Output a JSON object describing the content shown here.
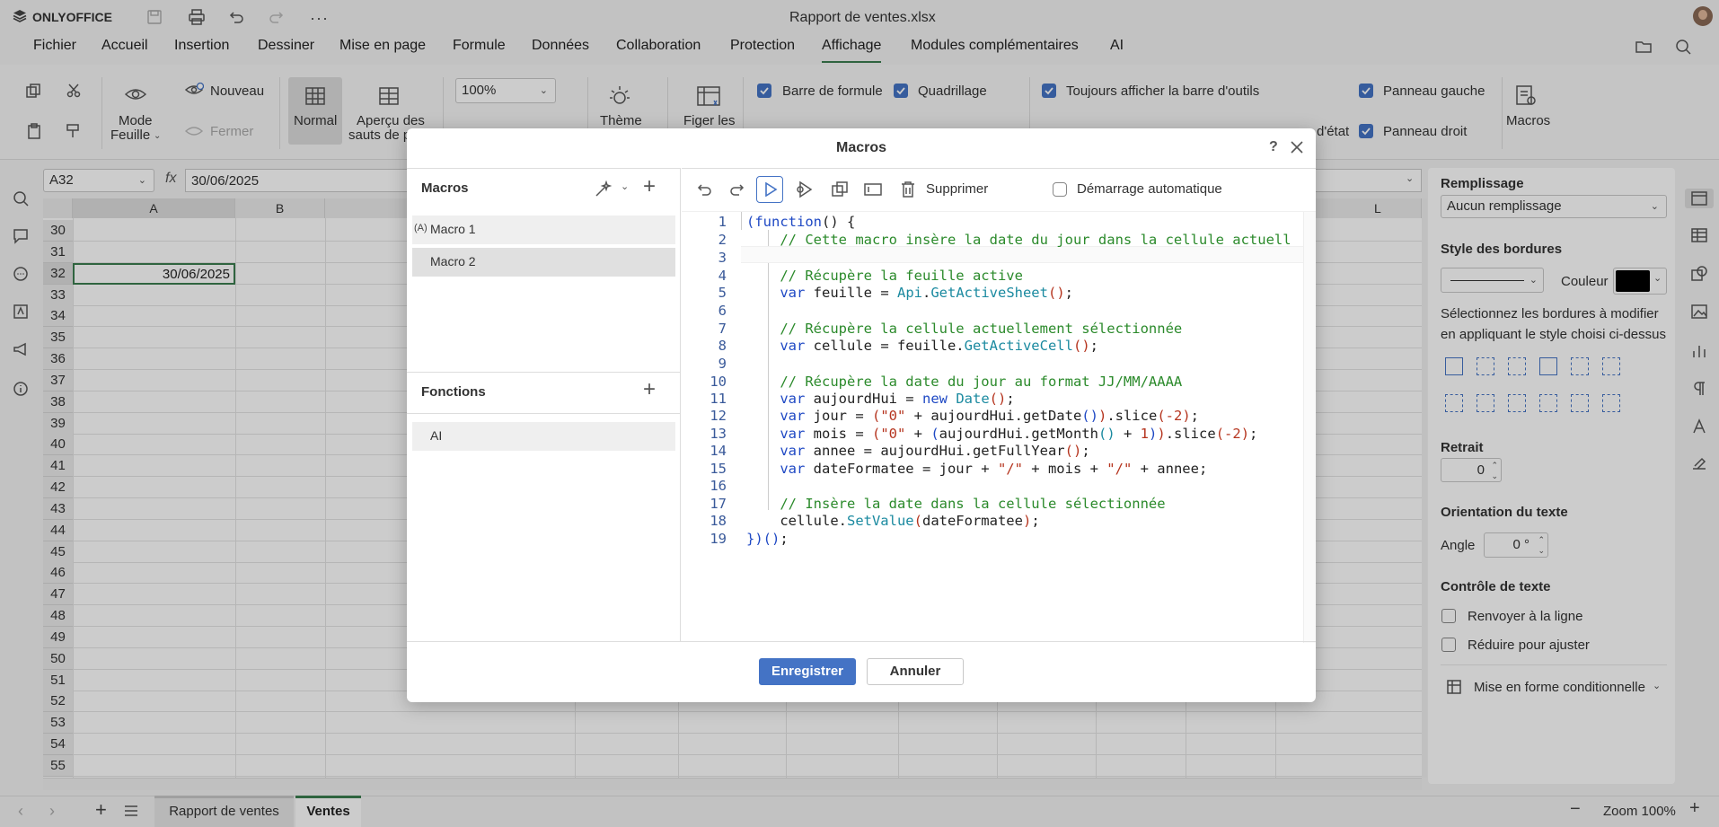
{
  "app": {
    "brand": "ONLYOFFICE",
    "doc_title": "Rapport de ventes.xlsx"
  },
  "menu": [
    "Fichier",
    "Accueil",
    "Insertion",
    "Dessiner",
    "Mise en page",
    "Formule",
    "Données",
    "Collaboration",
    "Protection",
    "Affichage",
    "Modules complémentaires",
    "AI"
  ],
  "menu_active": "Affichage",
  "ribbon": {
    "mode_label": "Mode",
    "feuille_label": "Feuille",
    "nouveau": "Nouveau",
    "fermer": "Fermer",
    "normal": "Normal",
    "apercu_line1": "Aperçu des",
    "apercu_line2": "sauts de p",
    "zoom": "100%",
    "theme": "Thème",
    "figer": "Figer les",
    "barre_formule": "Barre de formule",
    "quadrillage": "Quadrillage",
    "toujours_afficher": "Toujours afficher la barre d'outils",
    "panneau_gauche": "Panneau gauche",
    "panneau_droit": "Panneau droit",
    "combine_status": "d'état",
    "macros": "Macros"
  },
  "formula_bar": {
    "cell_ref": "A32",
    "fx": "fx",
    "value": "30/06/2025"
  },
  "sheet": {
    "columns": [
      "A",
      "B",
      "L"
    ],
    "rows": [
      "30",
      "31",
      "32",
      "33",
      "34",
      "35",
      "36",
      "37",
      "38",
      "39",
      "40",
      "41",
      "42",
      "43",
      "44",
      "45",
      "46",
      "47",
      "48",
      "49",
      "50",
      "51",
      "52",
      "53",
      "54",
      "55"
    ],
    "selected_cell_value": "30/06/2025"
  },
  "right_panel": {
    "remplissage": "Remplissage",
    "remplissage_value": "Aucun remplissage",
    "style_bordures": "Style des bordures",
    "couleur": "Couleur",
    "border_hint_1": "Sélectionnez les bordures à modifier",
    "border_hint_2": "en appliquant le style choisi ci-dessus",
    "retrait": "Retrait",
    "retrait_value": "0",
    "orientation": "Orientation du texte",
    "angle": "Angle",
    "angle_value": "0 °",
    "controle": "Contrôle de texte",
    "renvoyer": "Renvoyer à la ligne",
    "reduire": "Réduire pour ajuster",
    "mise_en_forme": "Mise en forme conditionnelle"
  },
  "bottom": {
    "sheet_tabs": [
      "Rapport de ventes",
      "Ventes"
    ],
    "active_tab": "Ventes",
    "zoom": "Zoom 100%"
  },
  "dialog": {
    "title": "Macros",
    "help": "?",
    "macros_header": "Macros",
    "macro_items": [
      {
        "prefix": "(A)",
        "label": "Macro 1"
      },
      {
        "prefix": "",
        "label": "Macro 2"
      }
    ],
    "functions_header": "Fonctions",
    "function_items": [
      "AI"
    ],
    "delete_label": "Supprimer",
    "autostart_label": "Démarrage automatique",
    "save_label": "Enregistrer",
    "cancel_label": "Annuler",
    "line_numbers": [
      "1",
      "2",
      "3",
      "4",
      "5",
      "6",
      "7",
      "8",
      "9",
      "10",
      "11",
      "12",
      "13",
      "14",
      "15",
      "16",
      "17",
      "18",
      "19"
    ]
  },
  "colors": {
    "accent_green": "#3b7d4f",
    "primary_blue": "#4473c5",
    "checkbox_blue": "#4473c5"
  }
}
